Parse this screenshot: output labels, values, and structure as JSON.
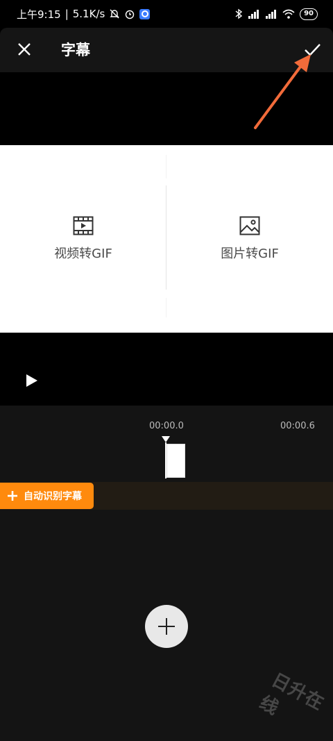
{
  "status_bar": {
    "time": "上午9:15",
    "network_speed": "5.1K/s",
    "battery": "90"
  },
  "header": {
    "title": "字幕",
    "close_icon": "close-icon",
    "confirm_icon": "check-icon"
  },
  "preview": {
    "left_label": "视频转GIF",
    "right_label": "图片转GIF",
    "left_icon": "film-icon",
    "right_icon": "image-icon"
  },
  "timeline": {
    "time_current": "00:00.0",
    "time_end": "00:00.6",
    "auto_subtitle_label": "自动识别字幕"
  },
  "watermark": "日升在线",
  "colors": {
    "accent": "#ff8a0d",
    "arrow": "#f26b3a"
  }
}
